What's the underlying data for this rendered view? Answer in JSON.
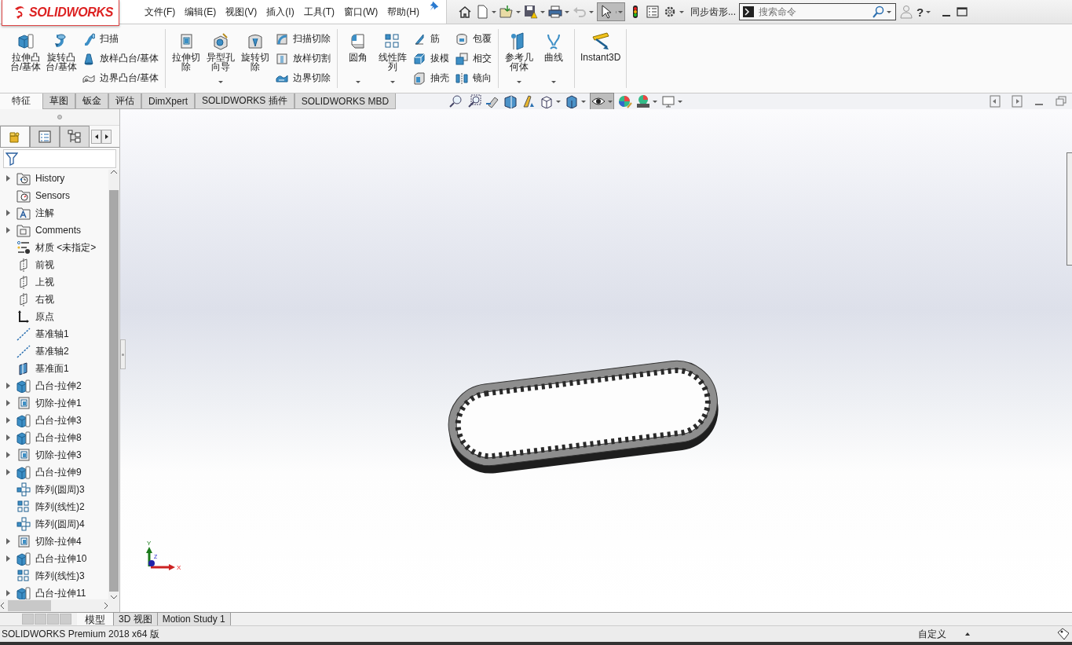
{
  "title_bar": {
    "logo": "SOLIDWORKS",
    "menus": [
      "文件(F)",
      "编辑(E)",
      "视图(V)",
      "插入(I)",
      "工具(T)",
      "窗口(W)",
      "帮助(H)"
    ],
    "document_title": "同步齿形...",
    "search": {
      "placeholder": "搜索命令"
    },
    "help": "?"
  },
  "ribbon": {
    "groups": [
      {
        "items": [
          {
            "kind": "large",
            "label_lines": [
              "拉伸凸",
              "台/基体"
            ],
            "dropdown": false
          },
          {
            "kind": "large",
            "label_lines": [
              "旋转凸",
              "台/基体"
            ],
            "dropdown": false
          },
          {
            "kind": "stack",
            "items": [
              {
                "label": "扫描"
              },
              {
                "label": "放样凸台/基体"
              },
              {
                "label": "边界凸台/基体"
              }
            ]
          }
        ]
      },
      {
        "items": [
          {
            "kind": "large",
            "label_lines": [
              "拉伸切",
              "除"
            ],
            "dropdown": false
          },
          {
            "kind": "large",
            "label_lines": [
              "异型孔",
              "向导"
            ],
            "dropdown": true
          },
          {
            "kind": "large",
            "label_lines": [
              "旋转切",
              "除"
            ],
            "dropdown": false
          },
          {
            "kind": "stack",
            "items": [
              {
                "label": "扫描切除"
              },
              {
                "label": "放样切割"
              },
              {
                "label": "边界切除"
              }
            ]
          }
        ]
      },
      {
        "items": [
          {
            "kind": "large",
            "label_lines": [
              "圆角"
            ],
            "dropdown": true
          },
          {
            "kind": "large",
            "label_lines": [
              "线性阵",
              "列"
            ],
            "dropdown": true
          },
          {
            "kind": "stack",
            "items": [
              {
                "label": "筋"
              },
              {
                "label": "拔模"
              },
              {
                "label": "抽壳"
              }
            ]
          },
          {
            "kind": "stack",
            "items": [
              {
                "label": "包覆"
              },
              {
                "label": "相交"
              },
              {
                "label": "镜向"
              }
            ]
          }
        ]
      },
      {
        "items": [
          {
            "kind": "large",
            "label_lines": [
              "参考几",
              "何体"
            ],
            "dropdown": true
          },
          {
            "kind": "large",
            "label_lines": [
              "曲线"
            ],
            "dropdown": true
          }
        ]
      },
      {
        "items": [
          {
            "kind": "large",
            "label_lines": [
              "Instant3D"
            ],
            "dropdown": false
          }
        ]
      }
    ]
  },
  "command_tabs": [
    {
      "label": "特征",
      "selected": true
    },
    {
      "label": "草图",
      "selected": false
    },
    {
      "label": "钣金",
      "selected": false
    },
    {
      "label": "评估",
      "selected": false
    },
    {
      "label": "DimXpert",
      "selected": false
    },
    {
      "label": "SOLIDWORKS 插件",
      "selected": false
    },
    {
      "label": "SOLIDWORKS MBD",
      "selected": false
    }
  ],
  "feature_tree": {
    "items": [
      {
        "kind": "history",
        "label": "History",
        "expandable": true
      },
      {
        "kind": "sensors",
        "label": "Sensors",
        "expandable": false
      },
      {
        "kind": "annotations",
        "label": "注解",
        "expandable": true
      },
      {
        "kind": "comments",
        "label": "Comments",
        "expandable": true
      },
      {
        "kind": "material",
        "label": "材质 <未指定>",
        "expandable": false
      },
      {
        "kind": "plane",
        "label": "前视",
        "expandable": false
      },
      {
        "kind": "plane",
        "label": "上视",
        "expandable": false
      },
      {
        "kind": "plane",
        "label": "右视",
        "expandable": false
      },
      {
        "kind": "origin",
        "label": "原点",
        "expandable": false
      },
      {
        "kind": "axis",
        "label": "基准轴1",
        "expandable": false
      },
      {
        "kind": "axis",
        "label": "基准轴2",
        "expandable": false
      },
      {
        "kind": "datum-plane",
        "label": "基准面1",
        "expandable": false
      },
      {
        "kind": "boss",
        "label": "凸台-拉伸2",
        "expandable": true
      },
      {
        "kind": "cut",
        "label": "切除-拉伸1",
        "expandable": true
      },
      {
        "kind": "boss",
        "label": "凸台-拉伸3",
        "expandable": true
      },
      {
        "kind": "boss",
        "label": "凸台-拉伸8",
        "expandable": true
      },
      {
        "kind": "cut",
        "label": "切除-拉伸3",
        "expandable": true
      },
      {
        "kind": "boss",
        "label": "凸台-拉伸9",
        "expandable": true
      },
      {
        "kind": "circular-pattern",
        "label": "阵列(圆周)3",
        "expandable": false
      },
      {
        "kind": "linear-pattern",
        "label": "阵列(线性)2",
        "expandable": false
      },
      {
        "kind": "circular-pattern",
        "label": "阵列(圆周)4",
        "expandable": false
      },
      {
        "kind": "cut",
        "label": "切除-拉伸4",
        "expandable": true
      },
      {
        "kind": "boss",
        "label": "凸台-拉伸10",
        "expandable": true
      },
      {
        "kind": "linear-pattern",
        "label": "阵列(线性)3",
        "expandable": false
      },
      {
        "kind": "boss",
        "label": "凸台-拉伸11",
        "expandable": true
      }
    ]
  },
  "triad": {
    "x": "X",
    "y": "Y",
    "z": "Z"
  },
  "bottom_tabs": [
    {
      "label": "模型",
      "selected": true
    },
    {
      "label": "3D 视图",
      "selected": false
    },
    {
      "label": "Motion Study 1",
      "selected": false
    }
  ],
  "status_bar": {
    "product": "SOLIDWORKS Premium 2018 x64 版",
    "units": "自定义"
  }
}
